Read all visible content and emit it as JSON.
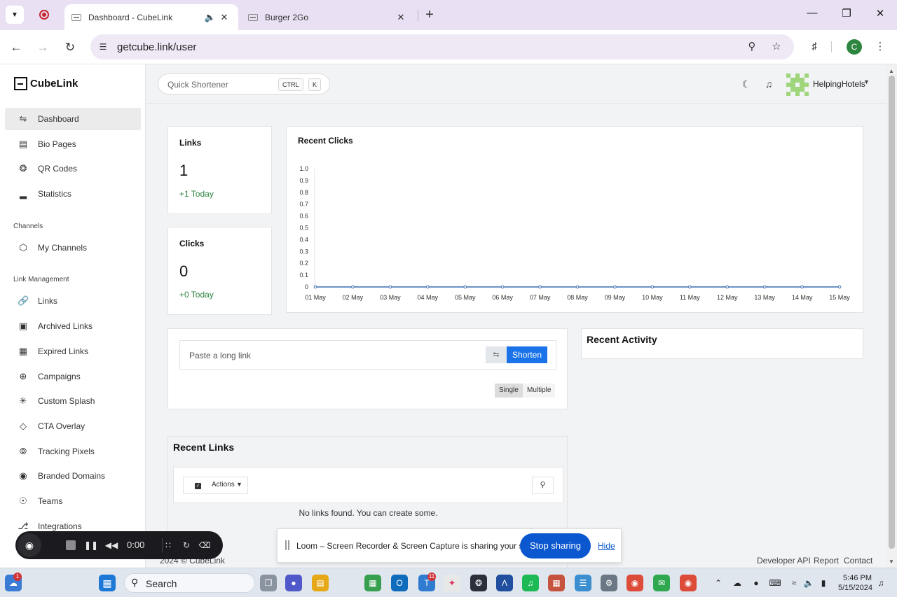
{
  "browser": {
    "tabs": [
      {
        "title": "Dashboard - CubeLink",
        "active": true
      },
      {
        "title": "Burger 2Go",
        "active": false
      }
    ],
    "url": "getcube.link/user",
    "profile_initial": "C"
  },
  "app": {
    "brand": "CubeLink",
    "search": {
      "placeholder": "Quick Shortener",
      "key1": "CTRL",
      "key2": "K"
    },
    "user": {
      "name": "HelpingHotels"
    }
  },
  "sidebar": {
    "items": [
      {
        "label": "Dashboard",
        "icon": "sliders-icon",
        "active": true
      },
      {
        "label": "Bio Pages",
        "icon": "book-icon"
      },
      {
        "label": "QR Codes",
        "icon": "aperture-icon"
      },
      {
        "label": "Statistics",
        "icon": "bar-chart-icon"
      }
    ],
    "channels_heading": "Channels",
    "channel_items": [
      {
        "label": "My Channels",
        "icon": "cube-icon"
      }
    ],
    "link_heading": "Link Management",
    "link_items": [
      {
        "label": "Links",
        "icon": "link-icon"
      },
      {
        "label": "Archived Links",
        "icon": "archive-icon"
      },
      {
        "label": "Expired Links",
        "icon": "calendar-icon"
      },
      {
        "label": "Campaigns",
        "icon": "crosshair-icon"
      },
      {
        "label": "Custom Splash",
        "icon": "loader-icon"
      },
      {
        "label": "CTA Overlay",
        "icon": "layers-icon"
      },
      {
        "label": "Tracking Pixels",
        "icon": "compass-icon"
      },
      {
        "label": "Branded Domains",
        "icon": "globe-icon"
      },
      {
        "label": "Teams",
        "icon": "users-icon"
      },
      {
        "label": "Integrations",
        "icon": "git-branch-icon"
      }
    ]
  },
  "stats": {
    "links": {
      "title": "Links",
      "value": "1",
      "delta": "+1 Today"
    },
    "clicks": {
      "title": "Clicks",
      "value": "0",
      "delta": "+0 Today"
    }
  },
  "chart_data": {
    "type": "line",
    "title": "Recent Clicks",
    "categories": [
      "01 May",
      "02 May",
      "03 May",
      "04 May",
      "05 May",
      "06 May",
      "07 May",
      "08 May",
      "09 May",
      "10 May",
      "11 May",
      "12 May",
      "13 May",
      "14 May",
      "15 May"
    ],
    "series": [
      {
        "values": [
          0,
          0,
          0,
          0,
          0,
          0,
          0,
          0,
          0,
          0,
          0,
          0,
          0,
          0,
          0
        ]
      }
    ],
    "ylim": [
      0,
      1.0
    ],
    "yticks": [
      0,
      0.1,
      0.2,
      0.3,
      0.4,
      0.5,
      0.6,
      0.7,
      0.8,
      0.9,
      1.0
    ],
    "ytick_labels": [
      "0",
      "0.1",
      "0.2",
      "0.3",
      "0.4",
      "0.5",
      "0.6",
      "0.7",
      "0.8",
      "0.9",
      "1.0"
    ],
    "color": "#3b6fb0",
    "grid": false
  },
  "shortener": {
    "placeholder": "Paste a long link",
    "button": "Shorten",
    "mode_single": "Single",
    "mode_multiple": "Multiple"
  },
  "activity": {
    "title": "Recent Activity"
  },
  "recent_links": {
    "title": "Recent Links",
    "actions": "Actions",
    "empty": "No links found. You can create some."
  },
  "footer": {
    "copyright": "2024 © CubeLink",
    "links": [
      "Developer API",
      "Report",
      "Contact"
    ]
  },
  "loom": {
    "time": "0:00",
    "banner": "Loom – Screen Recorder & Screen Capture is sharing your screen.",
    "stop": "Stop sharing",
    "hide": "Hide"
  },
  "taskbar": {
    "search": "Search",
    "time": "5:46 PM",
    "date": "5/15/2024",
    "weather_badge": "1",
    "teams_badge": "11"
  }
}
